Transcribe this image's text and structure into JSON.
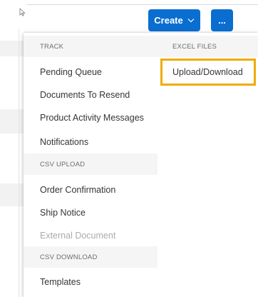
{
  "toolbar": {
    "create_label": "Create",
    "more_label": "...",
    "create_color": "#0a6ed1"
  },
  "menu": {
    "track": {
      "header": "TRACK",
      "items": [
        "Pending Queue",
        "Documents To Resend",
        "Product Activity Messages",
        "Notifications"
      ]
    },
    "csv_upload": {
      "header": "CSV UPLOAD",
      "items": [
        "Order Confirmation",
        "Ship Notice",
        "External Document"
      ]
    },
    "csv_download": {
      "header": "CSV DOWNLOAD",
      "items": [
        "Templates"
      ]
    },
    "excel_files": {
      "header": "EXCEL FILES",
      "items": [
        "Upload/Download"
      ]
    }
  },
  "highlight_color": "#f0ab00",
  "icons": {
    "cursor": "arrow-cursor-icon",
    "create_chevron": "chevron-down-icon"
  }
}
